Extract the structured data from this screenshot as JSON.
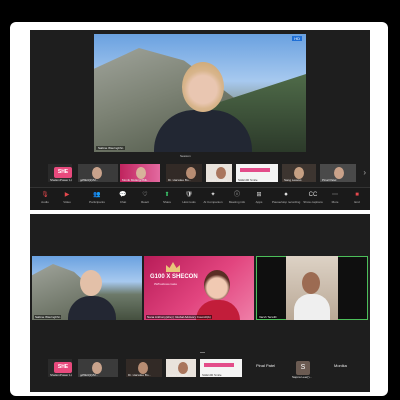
{
  "top": {
    "speaker_name": "Sabine Wieringhhn",
    "hd_badge": "HD",
    "caption": "Session",
    "thumbnails": [
      {
        "label": "SheEmPower Lt",
        "kind": "she"
      },
      {
        "label": "gd5E3(2)/M...",
        "kind": "face"
      },
      {
        "label": "Monik Mulang/JMk..",
        "kind": "pink"
      },
      {
        "label": "Dr. Harsdee Bo...",
        "kind": "face"
      },
      {
        "label": "Neeta Langoly",
        "kind": "face"
      },
      {
        "label": "SHE100 Smile",
        "kind": "slide"
      },
      {
        "label": "Sang Leaves",
        "kind": "face"
      },
      {
        "label": "Pinal Patel",
        "kind": "face"
      }
    ],
    "toolbar": [
      {
        "icon": "mic-icon",
        "glyph": "🎙",
        "label": "Audio",
        "red": true
      },
      {
        "icon": "video-icon",
        "glyph": "▶",
        "label": "Video",
        "red": true
      },
      {
        "icon": "participants-icon",
        "glyph": "👥",
        "label": "Participants",
        "red": false
      },
      {
        "icon": "chat-icon",
        "glyph": "💬",
        "label": "Chat",
        "red": false
      },
      {
        "icon": "react-icon",
        "glyph": "♡",
        "label": "React",
        "red": false
      },
      {
        "icon": "share-icon",
        "glyph": "⬆",
        "label": "Share",
        "red": false
      },
      {
        "icon": "host-tools-icon",
        "glyph": "🛡",
        "label": "Host tools",
        "red": false
      },
      {
        "icon": "companion-icon",
        "glyph": "✦",
        "label": "AI Companion",
        "red": false
      },
      {
        "icon": "info-icon",
        "glyph": "ⓘ",
        "label": "Meeting info",
        "red": false
      },
      {
        "icon": "apps-icon",
        "glyph": "⊞",
        "label": "Apps",
        "red": false
      },
      {
        "icon": "record-icon",
        "glyph": "⏺",
        "label": "Pause/stop recording",
        "red": false
      },
      {
        "icon": "captions-icon",
        "glyph": "CC",
        "label": "Show captions",
        "red": false
      },
      {
        "icon": "more-icon",
        "glyph": "⋯",
        "label": "More",
        "red": false
      },
      {
        "icon": "end-icon",
        "glyph": "■",
        "label": "End",
        "red": true
      }
    ]
  },
  "bottom": {
    "tiles": [
      {
        "label": "Sabine Wieringhhn"
      },
      {
        "label": "Nana Anthony(she) | Global Advisory Council(A)",
        "title": "G100 X SHECON",
        "sub": "#Whatdowemake"
      },
      {
        "label": "Varsh Terwilli"
      }
    ],
    "strip": [
      {
        "label": "SheEmPower Lt"
      },
      {
        "label": "gd5E3(2)/M..."
      },
      {
        "label": "Dr. Harsdee Bo..."
      },
      {
        "label": "Neeta Langoly"
      },
      {
        "label": "SHE100 Smile"
      },
      {
        "label": "Pinal Patel"
      },
      {
        "label": "Sapna Lee(r)...",
        "initial": "S"
      },
      {
        "label": "Monika"
      }
    ]
  }
}
